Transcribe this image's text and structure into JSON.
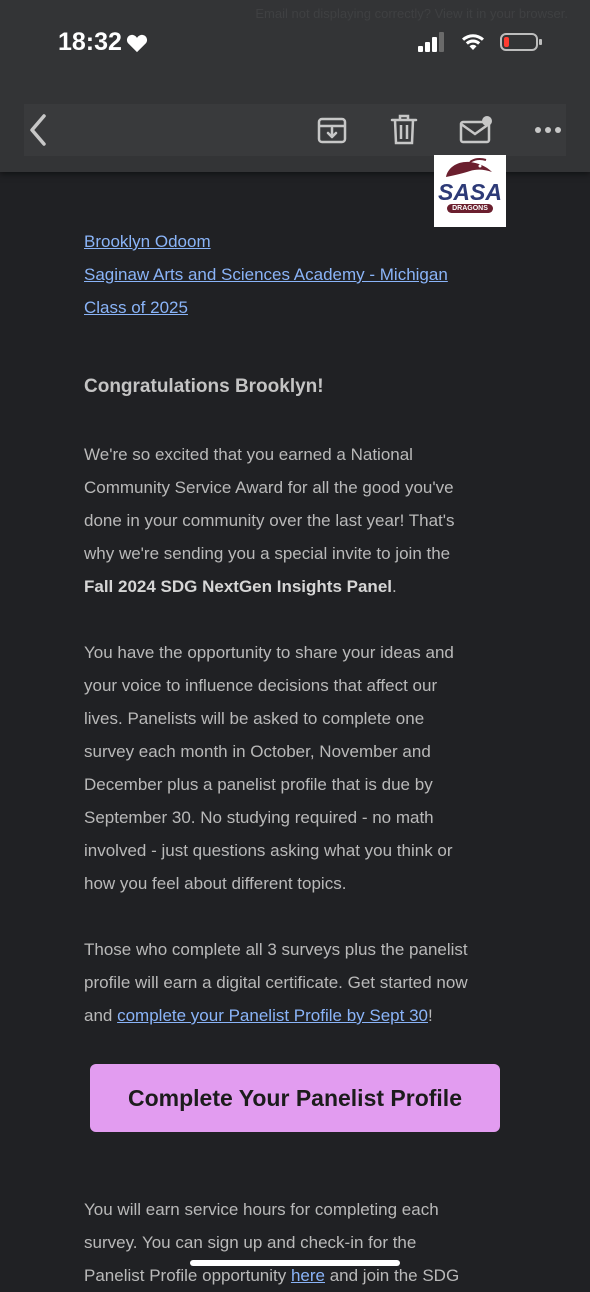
{
  "status_bar": {
    "time": "18:32",
    "ghost_text": "Email not displaying correctly? View it in your browser."
  },
  "toolbar": {
    "back_icon": "chevron-left-icon",
    "archive_icon": "archive-icon",
    "delete_icon": "trash-icon",
    "mark_unread_icon": "mail-unread-icon",
    "more_icon": "more-horizontal-icon"
  },
  "logo": {
    "name": "SASA",
    "sub": "DRAGONS"
  },
  "recipient": {
    "name": "Brooklyn Odoom",
    "school": "Saginaw Arts and Sciences Academy - Michigan",
    "class": "Class of 2025"
  },
  "greeting": "Congratulations Brooklyn!",
  "para1": {
    "lines": [
      "We're so excited that you earned a National",
      "Community Service Award for all the good you've",
      "done in your community over the last year! That's",
      "why we're sending you a special invite to join the"
    ],
    "bold": "Fall 2024 SDG NextGen Insights Panel",
    "end": "."
  },
  "para2": {
    "lines": [
      "You have the opportunity to share your ideas and",
      "your voice to influence decisions that affect our",
      "lives. Panelists will be asked to complete one",
      "survey each month in October, November and",
      "December plus a panelist profile that is due by",
      "September 30. No studying required - no math",
      "involved - just questions asking what you think or",
      "how you feel about different topics."
    ]
  },
  "para3": {
    "lines": [
      "Those who complete all 3 surveys plus the panelist",
      "profile will earn a digital certificate. Get started now"
    ],
    "pre": "and ",
    "link": "complete your Panelist Profile by Sept 30",
    "post": "!"
  },
  "cta": {
    "label": "Complete Your Panelist Profile",
    "color": "#e29cf0"
  },
  "para4": {
    "lines": [
      "You will earn service hours for completing each",
      "survey. You can sign up and check-in for the"
    ],
    "pre": "Panelist Profile opportunity ",
    "link": "here",
    "post": " and join the SDG"
  }
}
